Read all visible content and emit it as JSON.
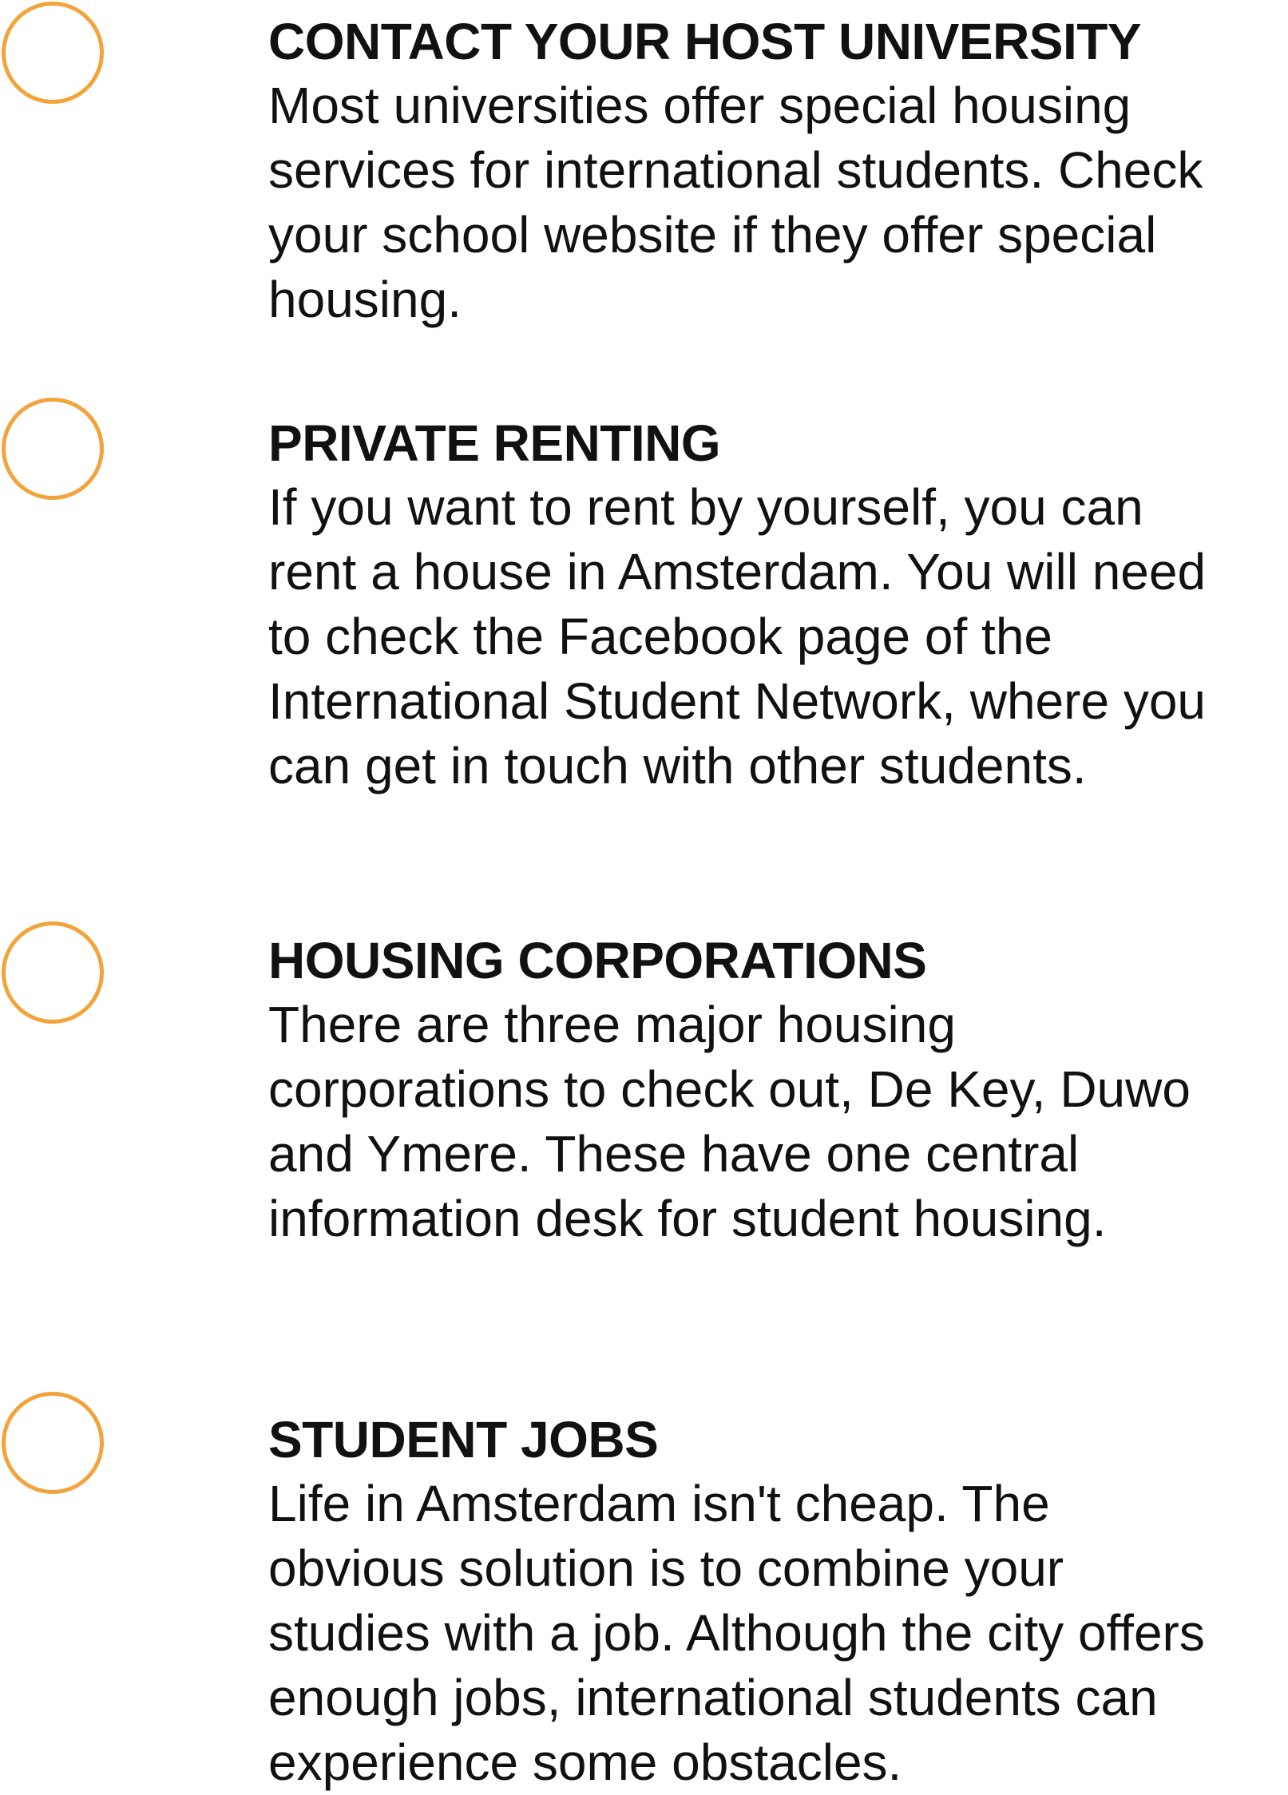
{
  "accent_color": "#f2a33a",
  "items": [
    {
      "title": "CONTACT YOUR HOST UNIVERSITY",
      "lines": [
        "Most universities offer special housing",
        "services for international students. Check",
        "your school website if they offer special",
        "housing."
      ]
    },
    {
      "title": "PRIVATE RENTING",
      "lines": [
        "If you want to rent by yourself, you can",
        "rent a house in Amsterdam. You will need",
        "to check the Facebook page of the",
        "International Student Network, where you",
        "can get in touch with other students."
      ]
    },
    {
      "title": "HOUSING CORPORATIONS",
      "lines": [
        "There are three major housing",
        "corporations to check out, De Key, Duwo",
        "and Ymere. These have one central",
        "information desk for student housing."
      ]
    },
    {
      "title": "STUDENT JOBS",
      "lines": [
        "Life in Amsterdam isn't cheap. The",
        "obvious solution is to combine your",
        "studies with a job. Although the city offers",
        "enough jobs, international students can",
        "experience some obstacles."
      ]
    }
  ]
}
